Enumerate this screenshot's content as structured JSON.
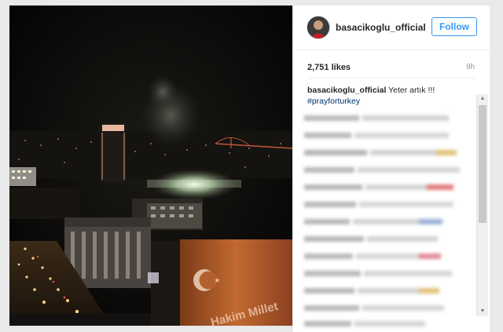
{
  "post": {
    "username": "basacikoglu_official",
    "follow_label": "Follow",
    "likes": "2,751 likes",
    "age": "9h",
    "caption_user": "basacikoglu_official",
    "caption_text": "Yeter artık !!!",
    "hashtag": "#prayforturkey"
  },
  "image": {
    "billboard_text": "Hakim Millet"
  },
  "colors": {
    "accent": "#3897f0",
    "hashtag": "#003569"
  }
}
